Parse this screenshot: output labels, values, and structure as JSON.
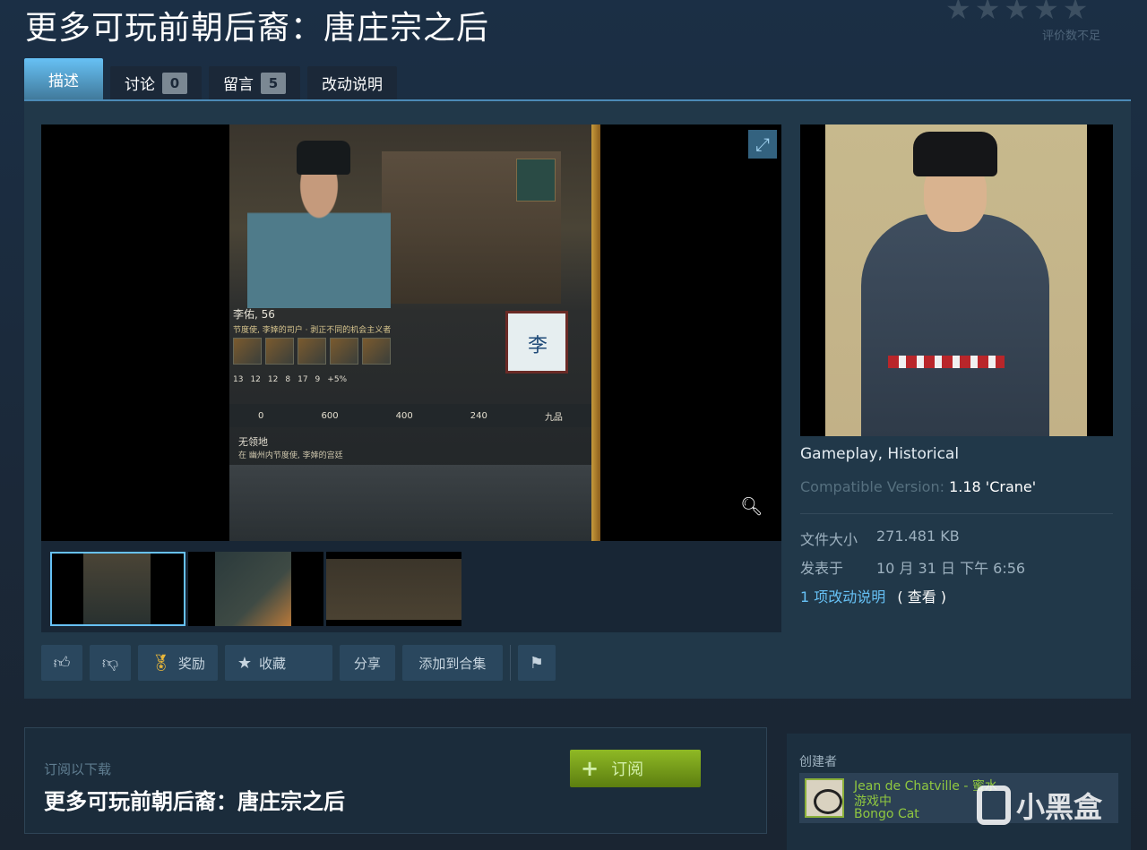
{
  "page": {
    "title": "更多可玩前朝后裔：唐庄宗之后",
    "rating_note": "评价数不足",
    "stars": [
      "★",
      "★",
      "★",
      "★",
      "★"
    ]
  },
  "tabs": [
    {
      "label": "描述",
      "active": true
    },
    {
      "label": "讨论",
      "count": "0"
    },
    {
      "label": "留言",
      "count": "5"
    },
    {
      "label": "改动说明"
    }
  ],
  "game": {
    "char_name": "李佑, 56",
    "char_sub": "节度使, 李婞的司户 · 剥正不同的机会主义者",
    "stats": [
      "13",
      "12",
      "12",
      "8",
      "17",
      "9",
      "+5%"
    ],
    "resources": [
      "0",
      "600",
      "400",
      "240",
      "九品"
    ],
    "area_title": "无领地",
    "area_sub": "在 幽州内节度使, 李婞的宫廷",
    "seal_label": "李"
  },
  "actions": {
    "reward": "奖励",
    "favorite": "收藏",
    "share": "分享",
    "add_collection": "添加到合集"
  },
  "details": {
    "tag1": "Gameplay",
    "tag_sep": ", ",
    "tag2": "Historical",
    "compat_label": "Compatible Version: ",
    "compat_value": "1.18 'Crane'",
    "size_label": "文件大小",
    "size_value": "271.481 KB",
    "posted_label": "发表于",
    "posted_value": "10 月 31 日 下午 6:56",
    "changes_link": "1 项改动说明",
    "changes_view": "( 查看 )"
  },
  "subscribe": {
    "small": "订阅以下载",
    "title": "更多可玩前朝后裔：唐庄宗之后",
    "button": "订阅",
    "plus": "+"
  },
  "creator": {
    "label": "创建者",
    "name": "Jean de Chatville - 蜜水",
    "status": "游戏中",
    "game": "Bongo Cat"
  },
  "watermark": "小黑盒",
  "colors": {
    "background": "#1b2838",
    "accent": "#67c1f5",
    "subscribe_green": "#8fb925",
    "link": "#66c0f4"
  }
}
